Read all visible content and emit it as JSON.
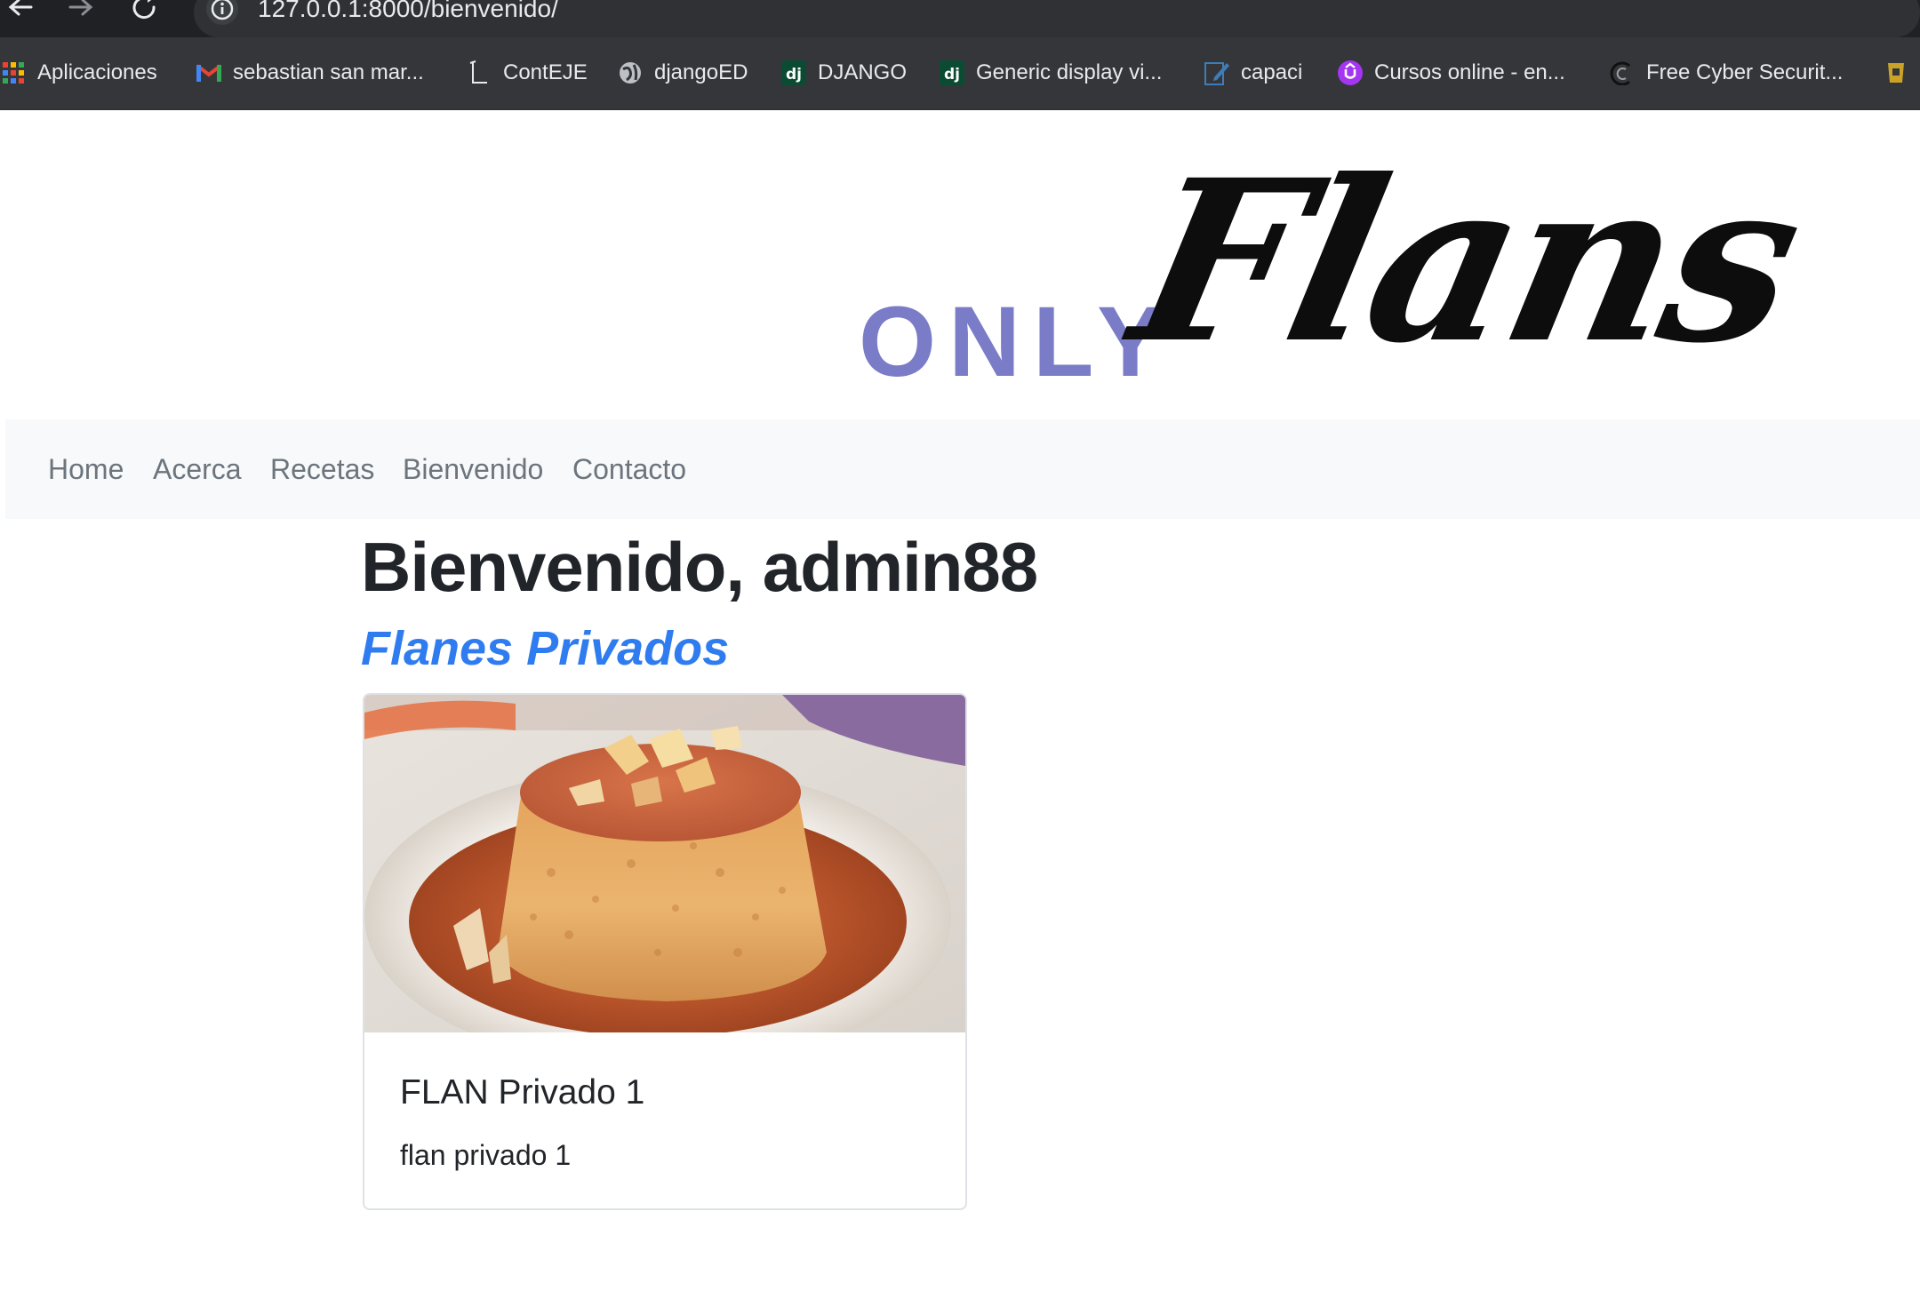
{
  "browser": {
    "url": "127.0.0.1:8000/bienvenido/",
    "bookmarks": [
      {
        "label": "Aplicaciones",
        "icon": "apps-grid-icon"
      },
      {
        "label": "sebastian san mar...",
        "icon": "gmail-icon"
      },
      {
        "label": "ContEJE",
        "icon": "document-icon"
      },
      {
        "label": "djangoED",
        "icon": "globe-icon"
      },
      {
        "label": "DJANGO",
        "icon": "django-icon"
      },
      {
        "label": "Generic display vi...",
        "icon": "django-icon"
      },
      {
        "label": "capaci",
        "icon": "edit-icon"
      },
      {
        "label": "Cursos online - en...",
        "icon": "udemy-icon"
      },
      {
        "label": "Free Cyber Securit...",
        "icon": "cyber-icon"
      }
    ]
  },
  "logo": {
    "only": "ONLY",
    "flans": "Flans",
    "only_color": "#7a7cc7"
  },
  "navbar": {
    "links": [
      "Home",
      "Acerca",
      "Recetas",
      "Bienvenido",
      "Contacto"
    ]
  },
  "main": {
    "welcome": "Bienvenido, admin88",
    "subtitle": "Flanes Privados",
    "subtitle_color": "#2f7cf0",
    "cards": [
      {
        "title": "FLAN Privado 1",
        "text": "flan privado 1"
      }
    ]
  }
}
